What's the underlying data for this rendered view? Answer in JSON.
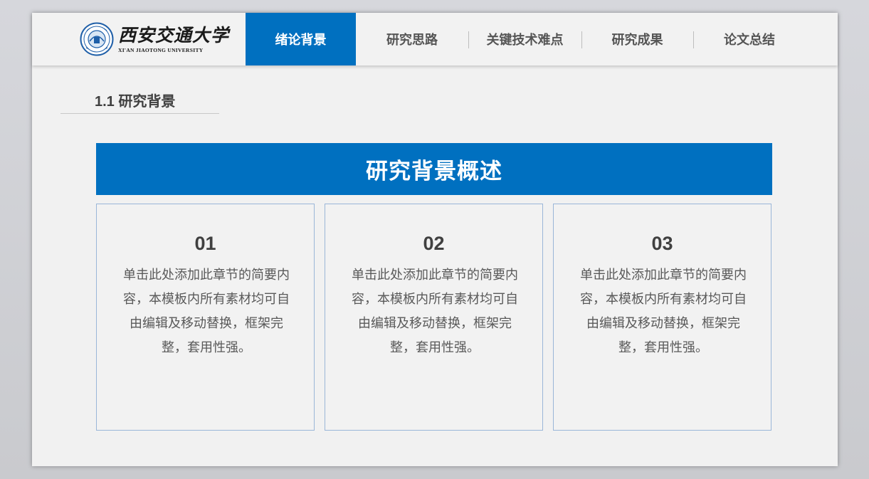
{
  "logo": {
    "name_cn": "西安交通大学",
    "name_en": "XI'AN JIAOTONG UNIVERSITY"
  },
  "nav": {
    "items": [
      {
        "label": "绪论背景",
        "active": true
      },
      {
        "label": "研究思路",
        "active": false
      },
      {
        "label": "关键技术难点",
        "active": false
      },
      {
        "label": "研究成果",
        "active": false
      },
      {
        "label": "论文总结",
        "active": false
      }
    ]
  },
  "section": {
    "title": "1.1 研究背景"
  },
  "banner": {
    "title": "研究背景概述"
  },
  "cards": [
    {
      "number": "01",
      "text": "单击此处添加此章节的简要内容，本模板内所有素材均可自由编辑及移动替换，框架完整，套用性强。"
    },
    {
      "number": "02",
      "text": "单击此处添加此章节的简要内容，本模板内所有素材均可自由编辑及移动替换，框架完整，套用性强。"
    },
    {
      "number": "03",
      "text": "单击此处添加此章节的简要内容，本模板内所有素材均可自由编辑及移动替换，框架完整，套用性强。"
    }
  ],
  "colors": {
    "accent": "#0070c0",
    "card_border": "#9ab6d8",
    "slide_bg": "#f1f1f1"
  }
}
